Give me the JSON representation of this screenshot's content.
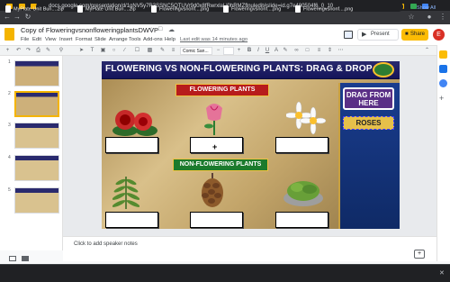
{
  "browser": {
    "url": "docs.google.com/presentation/d/1qNV5y7R3SSNC5QTUVr9d0x8fRwrxlaLl0hRMZflnuledit#slide=id.g7e480504f6_0_10"
  },
  "doc": {
    "logo_icon": "google-slides-logo-icon",
    "title": "Copy of FloweringvsnonfloweringplantsDWVP",
    "menus": [
      "File",
      "Edit",
      "View",
      "Insert",
      "Format",
      "Slide",
      "Arrange",
      "Tools",
      "Add-ons",
      "Help"
    ],
    "last_edit": "Last edit was 14 minutes ago",
    "present_label": "Present",
    "share_label": "Share",
    "avatar_initial": "E"
  },
  "toolbar": {
    "font_name": "Comic San...",
    "icons": [
      "add-icon",
      "undo-icon",
      "redo-icon",
      "print-icon",
      "paint-format-icon",
      "zoom-icon",
      "select-icon",
      "textbox-icon",
      "image-icon",
      "shape-icon",
      "line-icon",
      "comment-plus-icon",
      "bold-icon",
      "italic-icon",
      "underline-icon",
      "text-color-icon",
      "highlight-icon",
      "link-icon",
      "more-icon"
    ]
  },
  "filmstrip": {
    "numbers": [
      "1",
      "2",
      "3",
      "4",
      "5"
    ]
  },
  "slide": {
    "title": "FLOWERING VS NON-FLOWERING PLANTS: DRAG & DROP",
    "flowering_header": "FLOWERING PLANTS",
    "nonflowering_header": "NON-FLOWERING PLANTS",
    "drag_label": "DRAG FROM HERE",
    "drag_item": "ROSES",
    "plus_cursor": "+",
    "images": [
      "roses-image",
      "tulip-image",
      "daisies-image",
      "fern-image",
      "pinecone-image",
      "moss-image"
    ]
  },
  "notes": {
    "placeholder": "Click to add speaker notes"
  },
  "downloads": {
    "items": [
      "MyPlate Unit Bun....zip",
      "MyPlate Unit Bun....zip",
      "Floweringvsnonf....png",
      "Floweringvsnonf....png",
      "Floweringvsnonf....png"
    ],
    "show_all": "Show All"
  },
  "colors": {
    "title_bar": "#1c1c64",
    "flowering": "#b71c1c",
    "nonflowering": "#1b7a2c",
    "drag_button": "#5a2f86",
    "roses_box": "#e6c04a",
    "share": "#fbbc04"
  }
}
